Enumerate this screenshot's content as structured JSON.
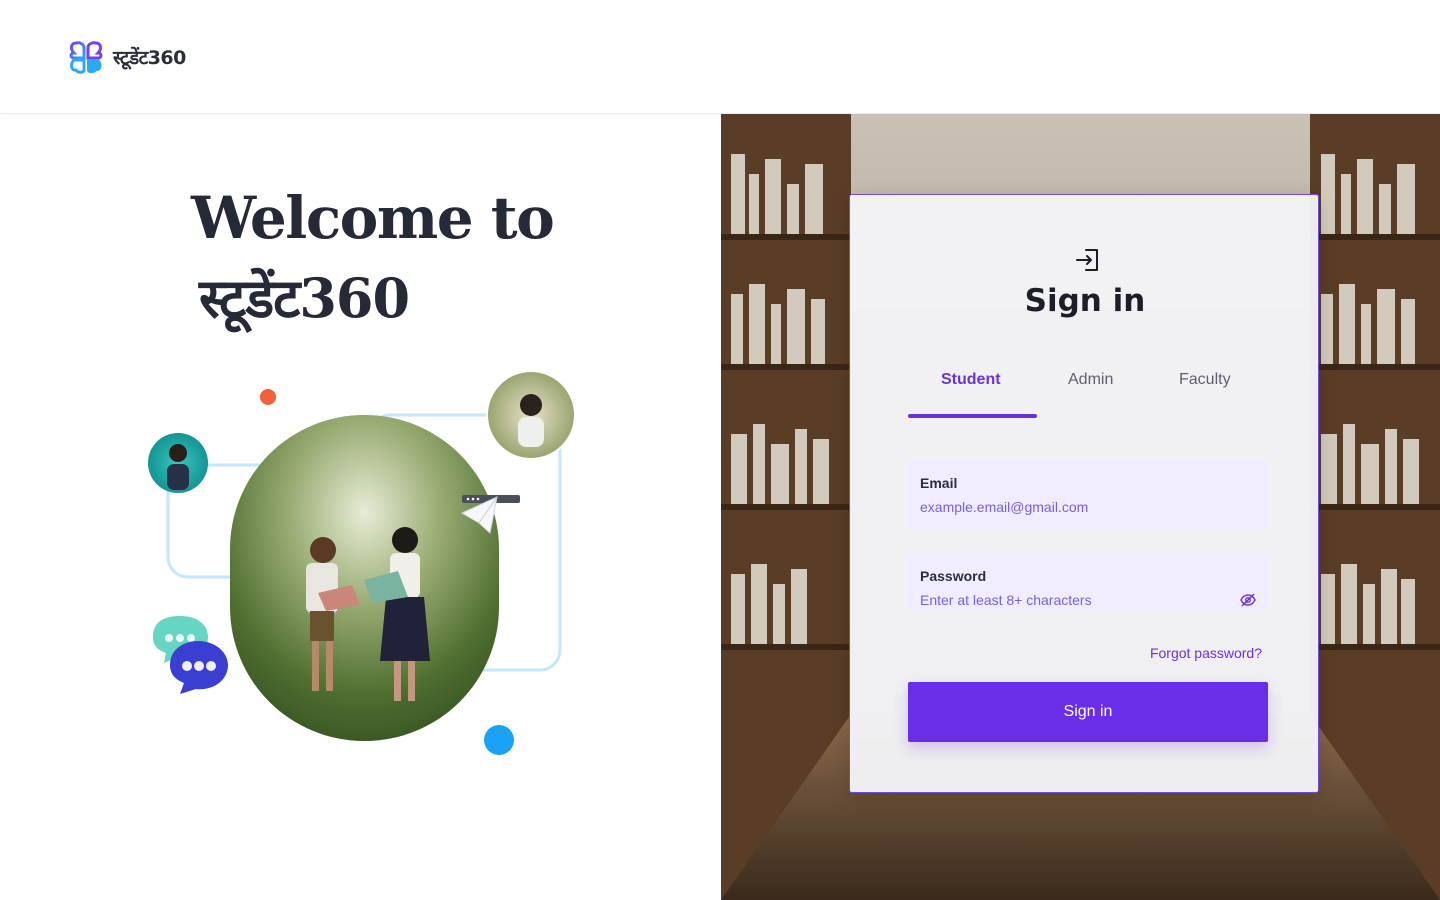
{
  "brand": {
    "name": "स्टूडेंट360"
  },
  "hero": {
    "line1": "Welcome to",
    "line2": "स्टूडेंट360"
  },
  "signin": {
    "title": "Sign in",
    "tabs": [
      {
        "label": "Student",
        "active": true
      },
      {
        "label": "Admin",
        "active": false
      },
      {
        "label": "Faculty",
        "active": false
      }
    ],
    "email": {
      "label": "Email",
      "value": "",
      "placeholder": "example.email@gmail.com"
    },
    "password": {
      "label": "Password",
      "value": "",
      "placeholder": "Enter at least 8+ characters"
    },
    "forgot_label": "Forgot password?",
    "submit_label": "Sign in"
  },
  "colors": {
    "accent": "#6a2ee8",
    "field_bg": "#f1ecff",
    "heading": "#262a36",
    "dot_orange": "#f4603a",
    "dot_blue": "#1aa3f5"
  },
  "icons": {
    "logo": "flower-logo-icon",
    "signin": "sign-in-arrow-icon",
    "password_toggle": "eye-off-icon",
    "chat": "chat-bubble-icon",
    "plane": "paper-plane-icon"
  }
}
